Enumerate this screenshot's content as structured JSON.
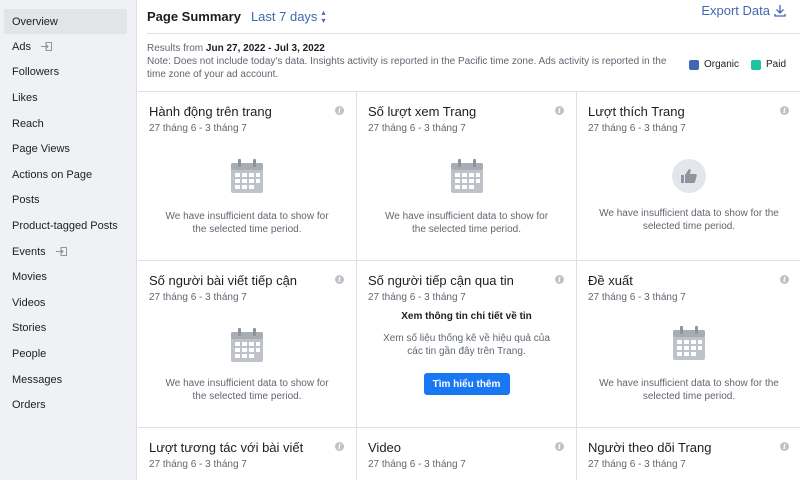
{
  "sidebar": {
    "items": [
      {
        "label": "Overview",
        "active": true
      },
      {
        "label": "Ads",
        "external": true
      },
      {
        "label": "Followers"
      },
      {
        "label": "Likes"
      },
      {
        "label": "Reach"
      },
      {
        "label": "Page Views"
      },
      {
        "label": "Actions on Page"
      },
      {
        "label": "Posts"
      },
      {
        "label": "Product-tagged Posts"
      },
      {
        "label": "Events",
        "external": true
      },
      {
        "label": "Movies"
      },
      {
        "label": "Videos"
      },
      {
        "label": "Stories"
      },
      {
        "label": "People"
      },
      {
        "label": "Messages"
      },
      {
        "label": "Orders"
      }
    ]
  },
  "header": {
    "title": "Page Summary",
    "range": "Last 7 days",
    "export": "Export Data"
  },
  "info": {
    "results_prefix": "Results from ",
    "results_range": "Jun 27, 2022 - Jul 3, 2022",
    "note": "Note: Does not include today's data. Insights activity is reported in the Pacific time zone. Ads activity is reported in the time zone of your ad account."
  },
  "legend": {
    "organic": "Organic",
    "paid": "Paid",
    "organic_color": "#4267b2",
    "paid_color": "#20c3a0"
  },
  "insufficient": "We have insufficient data to show for the selected time period.",
  "cards": [
    {
      "title": "Hành động trên trang",
      "date": "27 tháng 6 - 3 tháng 7",
      "kind": "calendar"
    },
    {
      "title": "Số lượt xem Trang",
      "date": "27 tháng 6 - 3 tháng 7",
      "kind": "calendar"
    },
    {
      "title": "Lượt thích Trang",
      "date": "27 tháng 6 - 3 tháng 7",
      "kind": "like"
    },
    {
      "title": "Số người bài viết tiếp cận",
      "date": "27 tháng 6 - 3 tháng 7",
      "kind": "calendar"
    },
    {
      "title": "Số người tiếp cận qua tin",
      "date": "27 tháng 6 - 3 tháng 7",
      "kind": "story",
      "story_heading": "Xem thông tin chi tiết về tin",
      "story_text": "Xem số liệu thống kê về hiệu quả của các tin gần đây trên Trang.",
      "button": "Tìm hiểu thêm"
    },
    {
      "title": "Đề xuất",
      "date": "27 tháng 6 - 3 tháng 7",
      "kind": "calendar"
    },
    {
      "title": "Lượt tương tác với bài viết",
      "date": "27 tháng 6 - 3 tháng 7",
      "kind": "empty"
    },
    {
      "title": "Video",
      "date": "27 tháng 6 - 3 tháng 7",
      "kind": "empty"
    },
    {
      "title": "Người theo dõi Trang",
      "date": "27 tháng 6 - 3 tháng 7",
      "kind": "empty"
    }
  ]
}
